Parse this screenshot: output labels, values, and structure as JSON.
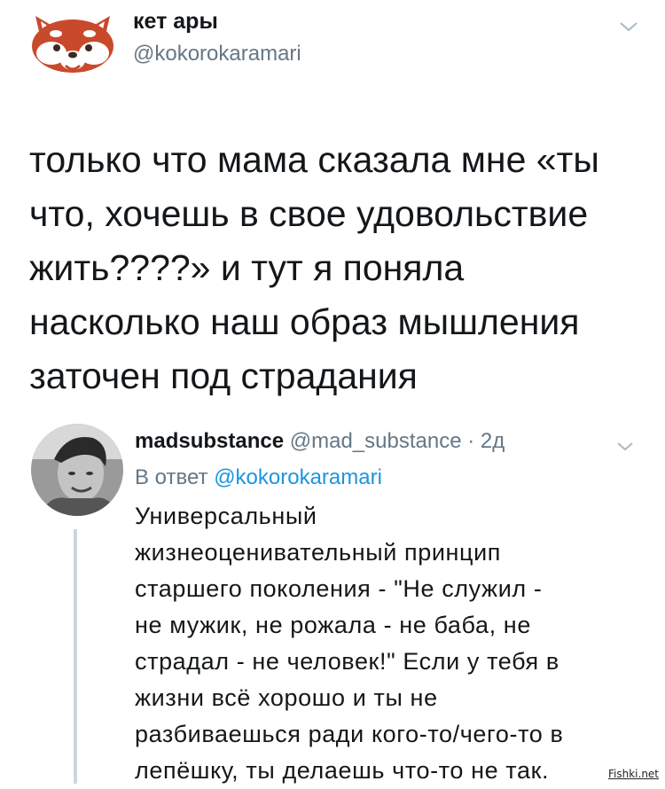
{
  "main_tweet": {
    "display_name": "кет ары",
    "handle": "@kokorokaramari",
    "text": "только что мама сказала мне «ты\nчто, хочешь в свое удовольствие\nжить????» и тут я поняла\nнасколько наш образ мышления\nзаточен под страдания",
    "avatar_icon": "red-panda-icon"
  },
  "reply": {
    "display_name": "madsubstance",
    "meta": "@mad_substance · 2д",
    "reply_to_prefix": "В ответ",
    "reply_to_handle": "@kokorokaramari",
    "text": "Универсальный\nжизнеоценивательный принцип\nстаршего поколения - \"Не служил -\nне мужик, не рожала - не баба, не\nстрадал - не человек!\" Если у тебя в\nжизни всё хорошо и ты не\nразбиваешься ради кого-то/чего-то в\nлепёшку, ты делаешь что-то не так.",
    "avatar_icon": "user-photo-avatar"
  },
  "watermark": "Fishki.net",
  "colors": {
    "text": "#14171a",
    "secondary": "#657786",
    "link": "#1b95e0",
    "avatar_panda": "#c9492c"
  }
}
